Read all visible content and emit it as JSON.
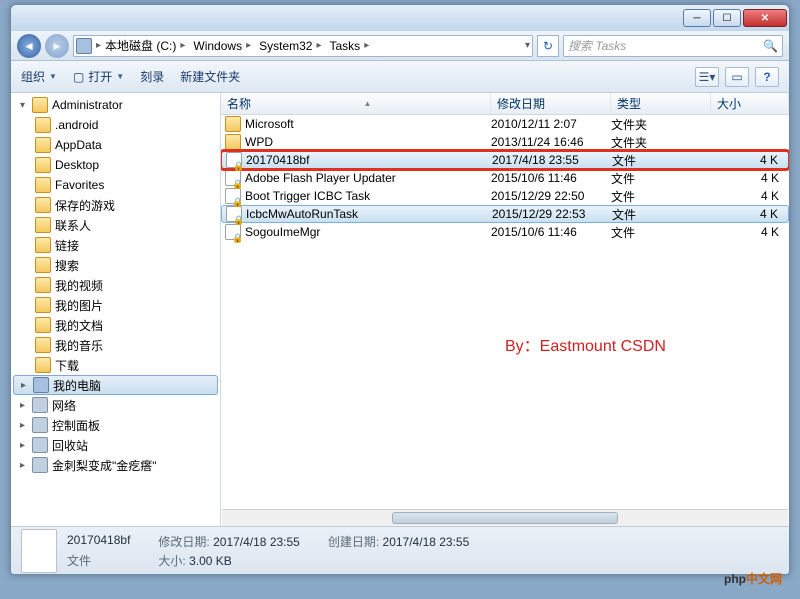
{
  "breadcrumbs": [
    "本地磁盘 (C:)",
    "Windows",
    "System32",
    "Tasks"
  ],
  "search": {
    "placeholder": "搜索 Tasks"
  },
  "toolbar": {
    "org": "组织",
    "open": "打开",
    "burn": "刻录",
    "newfolder": "新建文件夹"
  },
  "columns": {
    "name": "名称",
    "date": "修改日期",
    "type": "类型",
    "size": "大小"
  },
  "tree": {
    "top": "Administrator",
    "items": [
      ".android",
      "AppData",
      "Desktop",
      "Favorites",
      "保存的游戏",
      "联系人",
      "链接",
      "搜索",
      "我的视频",
      "我的图片",
      "我的文档",
      "我的音乐",
      "下载"
    ],
    "computer": "我的电脑",
    "bottom": [
      "网络",
      "控制面板",
      "回收站",
      "金刺梨变成\"金疙瘩\""
    ]
  },
  "files": [
    {
      "name": "Microsoft",
      "date": "2010/12/11 2:07",
      "type": "文件夹",
      "size": "",
      "icon": "fold"
    },
    {
      "name": "WPD",
      "date": "2013/11/24 16:46",
      "type": "文件夹",
      "size": "",
      "icon": "fold"
    },
    {
      "name": "20170418bf",
      "date": "2017/4/18 23:55",
      "type": "文件",
      "size": "4 K",
      "icon": "file",
      "lock": true,
      "boxed": true,
      "selected": true
    },
    {
      "name": "Adobe Flash Player Updater",
      "date": "2015/10/6 11:46",
      "type": "文件",
      "size": "4 K",
      "icon": "file",
      "lock": true
    },
    {
      "name": "Boot Trigger ICBC Task",
      "date": "2015/12/29 22:50",
      "type": "文件",
      "size": "4 K",
      "icon": "file",
      "lock": true
    },
    {
      "name": "IcbcMwAutoRunTask",
      "date": "2015/12/29 22:53",
      "type": "文件",
      "size": "4 K",
      "icon": "file",
      "lock": true,
      "selected": true
    },
    {
      "name": "SogouImeMgr",
      "date": "2015/10/6 11:46",
      "type": "文件",
      "size": "4 K",
      "icon": "file",
      "lock": true
    }
  ],
  "details": {
    "title": "20170418bf",
    "type": "文件",
    "mod_label": "修改日期:",
    "mod": "2017/4/18 23:55",
    "create_label": "创建日期:",
    "create": "2017/4/18 23:55",
    "size_label": "大小:",
    "size": "3.00 KB"
  },
  "watermark": "By：Eastmount CSDN",
  "logo": {
    "a": "php",
    "b": "中文网"
  }
}
